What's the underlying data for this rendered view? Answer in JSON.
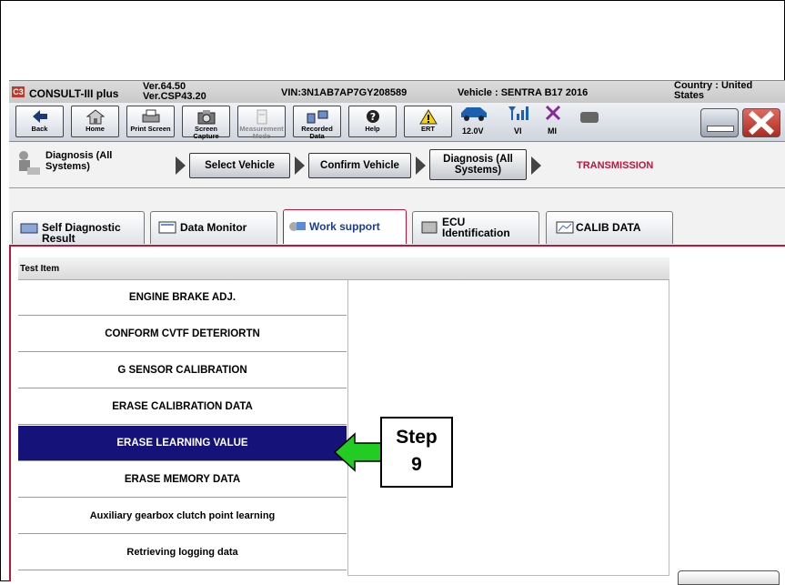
{
  "titlebar": {
    "logo": "C3",
    "app_name": "CONSULT-III plus",
    "version_line1": "Ver.64.50",
    "version_line2": "Ver.CSP43.20",
    "vin": "VIN:3N1AB7AP7GY208589",
    "vehicle": "Vehicle : SENTRA B17 2016",
    "country_line1": "Country : United",
    "country_line2": "States"
  },
  "toolbar": {
    "buttons": [
      {
        "label": "Back",
        "icon": "back-arrow-icon"
      },
      {
        "label": "Home",
        "icon": "home-icon"
      },
      {
        "label": "Print Screen",
        "icon": "printer-icon"
      },
      {
        "label": "Screen Capture",
        "icon": "camera-icon"
      },
      {
        "label": "Measurement Mode",
        "icon": "measurement-icon"
      },
      {
        "label": "Recorded Data",
        "icon": "recorded-data-icon"
      },
      {
        "label": "Help",
        "icon": "help-icon"
      },
      {
        "label": "ERT",
        "icon": "warning-icon"
      }
    ],
    "battery_voltage": "12.0V",
    "vi_label": "VI",
    "mi_label": "MI"
  },
  "breadcrumb": {
    "first": "Diagnosis (All Systems)",
    "steps": [
      "Select Vehicle",
      "Confirm Vehicle",
      "Diagnosis (All Systems)"
    ],
    "current": "TRANSMISSION"
  },
  "tabs": [
    {
      "label": "Self Diagnostic Result"
    },
    {
      "label": "Data Monitor"
    },
    {
      "label": "Work support"
    },
    {
      "label": "ECU Identification"
    },
    {
      "label": "CALIB DATA"
    }
  ],
  "test_list": {
    "header": "Test Item",
    "items": [
      "ENGINE BRAKE ADJ.",
      "CONFORM CVTF DETERIORTN",
      "G SENSOR CALIBRATION",
      "ERASE CALIBRATION DATA",
      "ERASE LEARNING VALUE",
      "ERASE MEMORY DATA",
      "Auxiliary gearbox clutch point learning",
      "Retrieving logging data"
    ],
    "selected_index": 4
  },
  "callout": {
    "line1": "Step",
    "line2": "9"
  },
  "colors": {
    "selected_row": "#15127a",
    "accent_red": "#c0143c",
    "callout_arrow": "#22cc22"
  }
}
